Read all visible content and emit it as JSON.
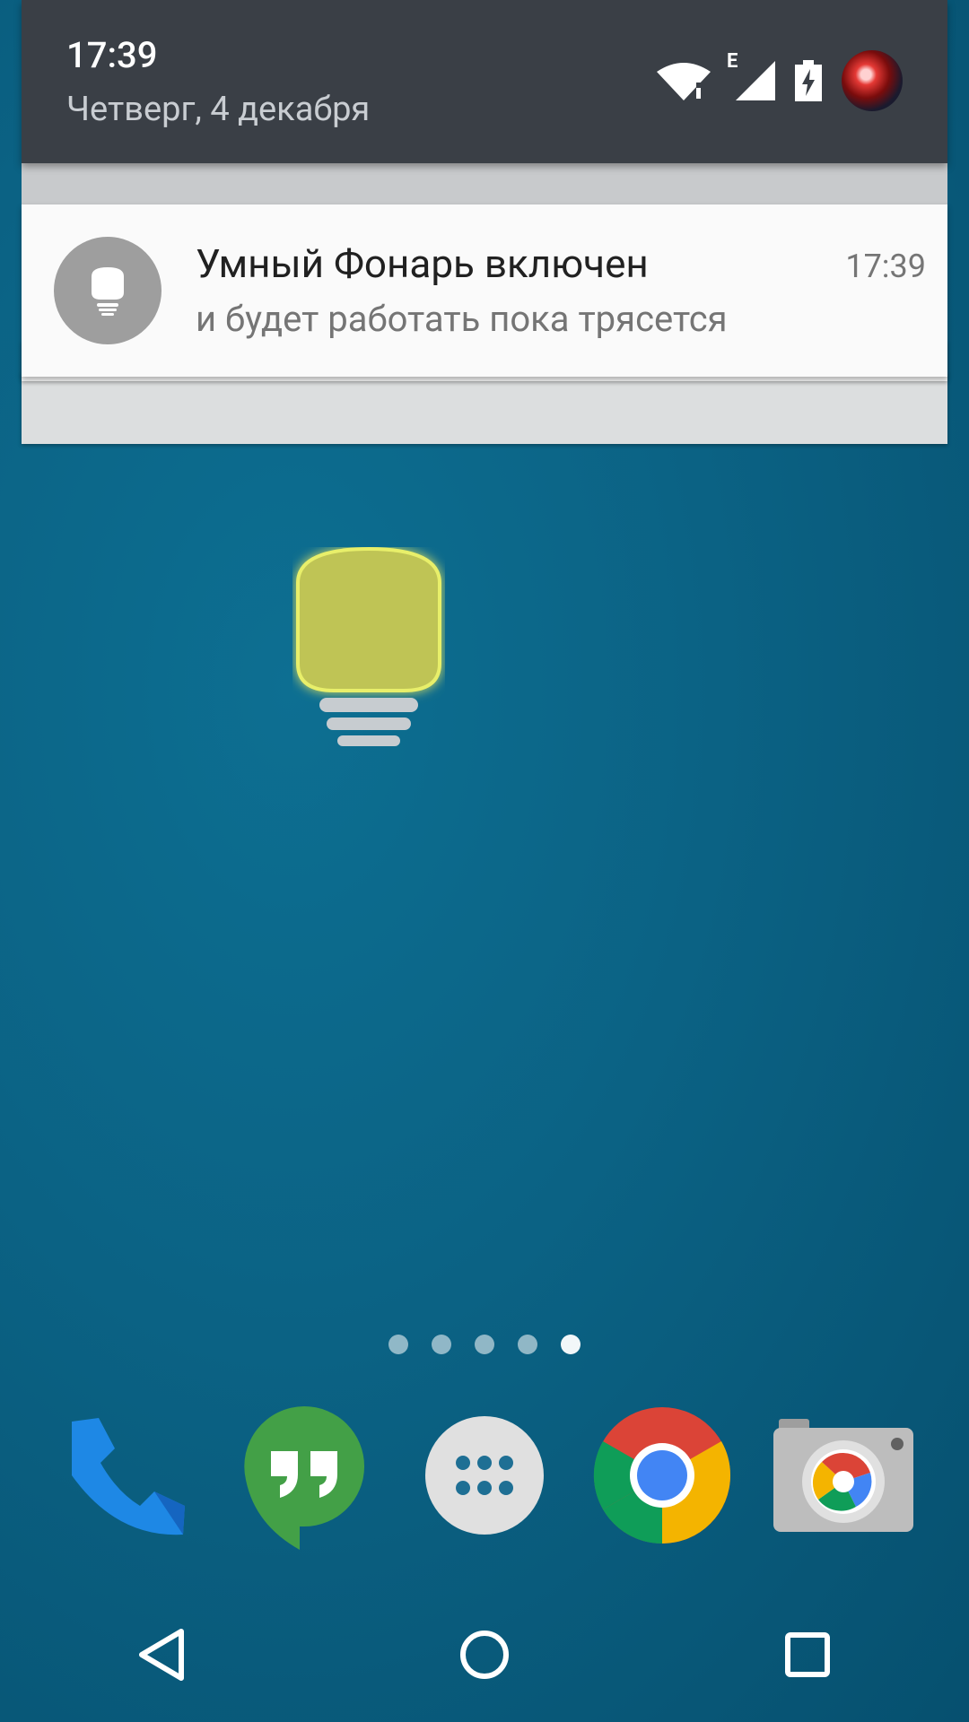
{
  "shade": {
    "time": "17:39",
    "date": "Четверг, 4 декабря",
    "network_type": "E"
  },
  "notification": {
    "title": "Умный Фонарь включен",
    "text": "и будет работать пока трясется",
    "time": "17:39",
    "icon": "lightbulb-icon"
  },
  "home": {
    "widget_icon": "lightbulb-widget-icon",
    "page_count": 5,
    "active_page": 5
  },
  "dock": {
    "apps": [
      {
        "name": "phone-icon"
      },
      {
        "name": "hangouts-icon"
      },
      {
        "name": "app-drawer-icon"
      },
      {
        "name": "chrome-icon"
      },
      {
        "name": "camera-icon"
      }
    ]
  },
  "navbar": {
    "buttons": [
      "back-icon",
      "home-icon",
      "recents-icon"
    ]
  },
  "colors": {
    "shade_bg": "#3a3f46",
    "wallpaper": "#0b6284",
    "bulb": "#bfc455"
  }
}
